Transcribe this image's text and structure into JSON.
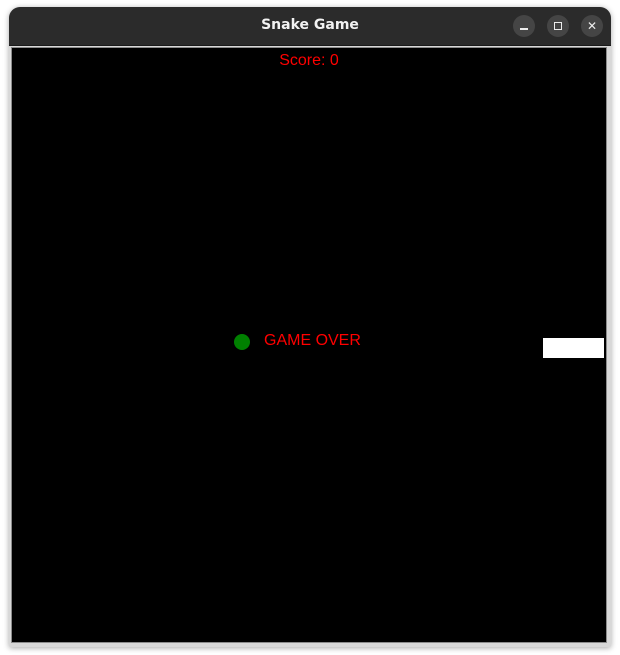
{
  "window": {
    "title": "Snake Game",
    "controls": {
      "minimize_icon": "minimize-icon",
      "maximize_icon": "maximize-icon",
      "close_icon": "close-icon",
      "close_glyph": "✕"
    }
  },
  "game": {
    "score_text": "Score: 0",
    "game_over_text": "GAME OVER",
    "colors": {
      "background": "#000000",
      "text": "#ff0000",
      "food": "#008000",
      "snake": "#ffffff"
    }
  }
}
